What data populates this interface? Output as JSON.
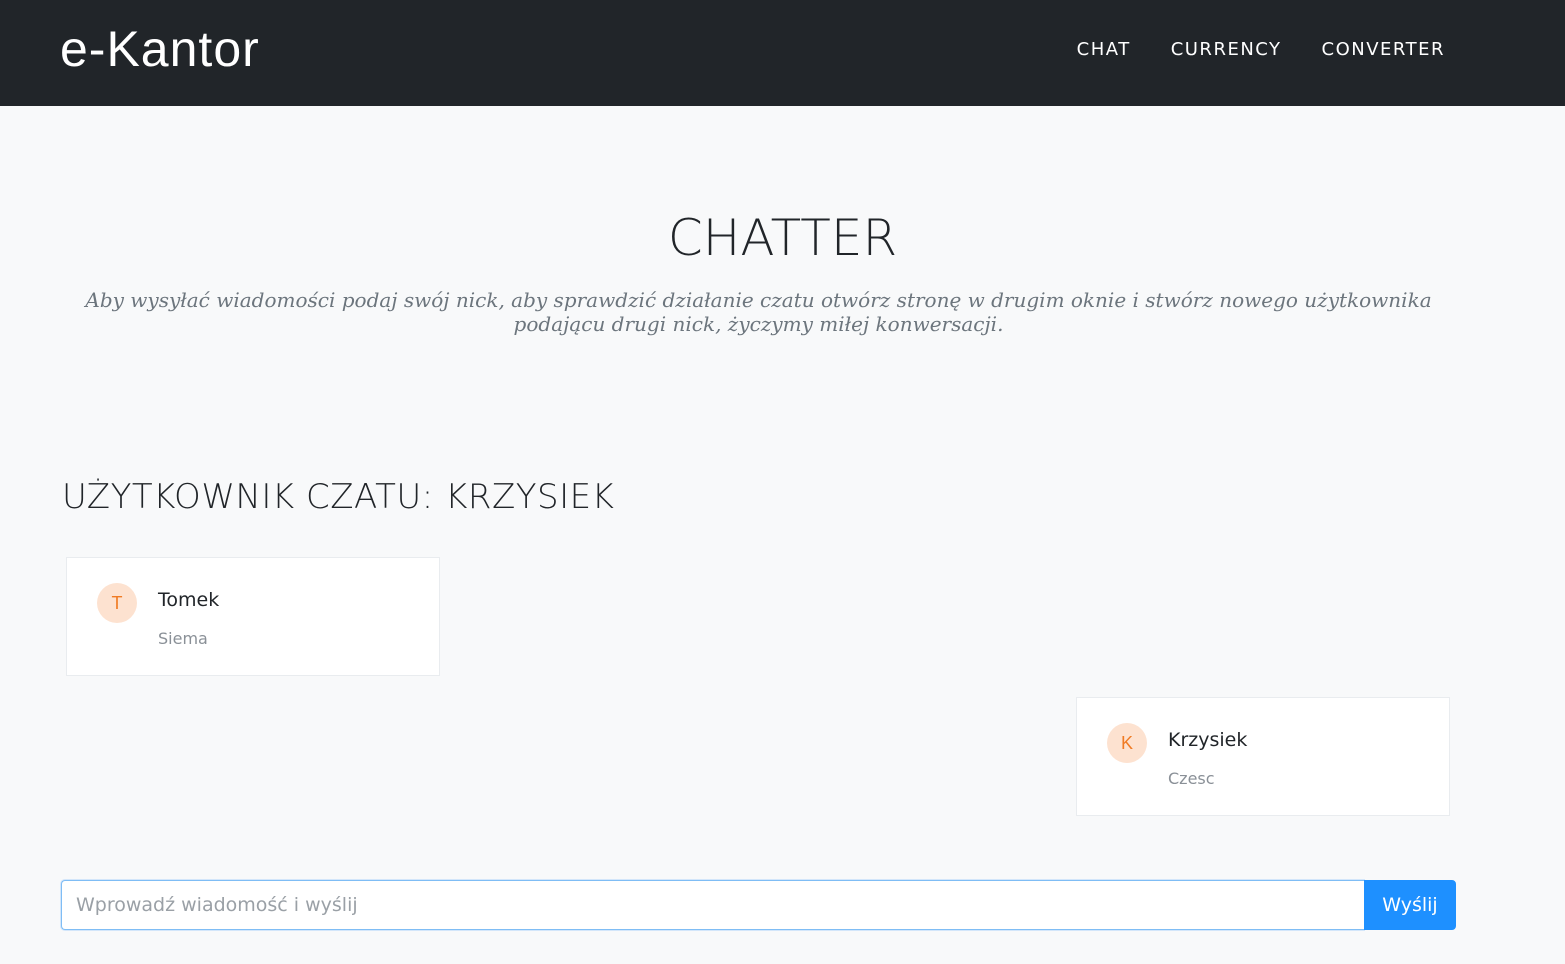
{
  "navbar": {
    "brand": "e-Kantor",
    "links": [
      {
        "label": "CHAT"
      },
      {
        "label": "CURRENCY"
      },
      {
        "label": "CONVERTER"
      }
    ]
  },
  "hero": {
    "title": "CHATTER",
    "subtitle": "Aby wysyłać wiadomości podaj swój nick, aby sprawdzić działanie czatu otwórz stronę w drugim oknie i stwórz nowego użytkownika podającu drugi nick, życzymy miłej konwersacji."
  },
  "chat": {
    "user_heading": "UŻYTKOWNIK CZATU: KRZYSIEK",
    "messages": [
      {
        "initial": "T",
        "name": "Tomek",
        "text": "Siema",
        "side": "left"
      },
      {
        "initial": "K",
        "name": "Krzysiek",
        "text": "Czesc",
        "side": "right"
      }
    ],
    "input": {
      "value": "",
      "placeholder": "Wprowadź wiadomość i wyślij"
    },
    "send_label": "Wyślij"
  },
  "colors": {
    "navbar_bg": "#212529",
    "page_bg": "#f8f9fa",
    "avatar_bg": "#fde2d0",
    "avatar_text": "#f07b24",
    "send_button": "#1e90ff"
  }
}
